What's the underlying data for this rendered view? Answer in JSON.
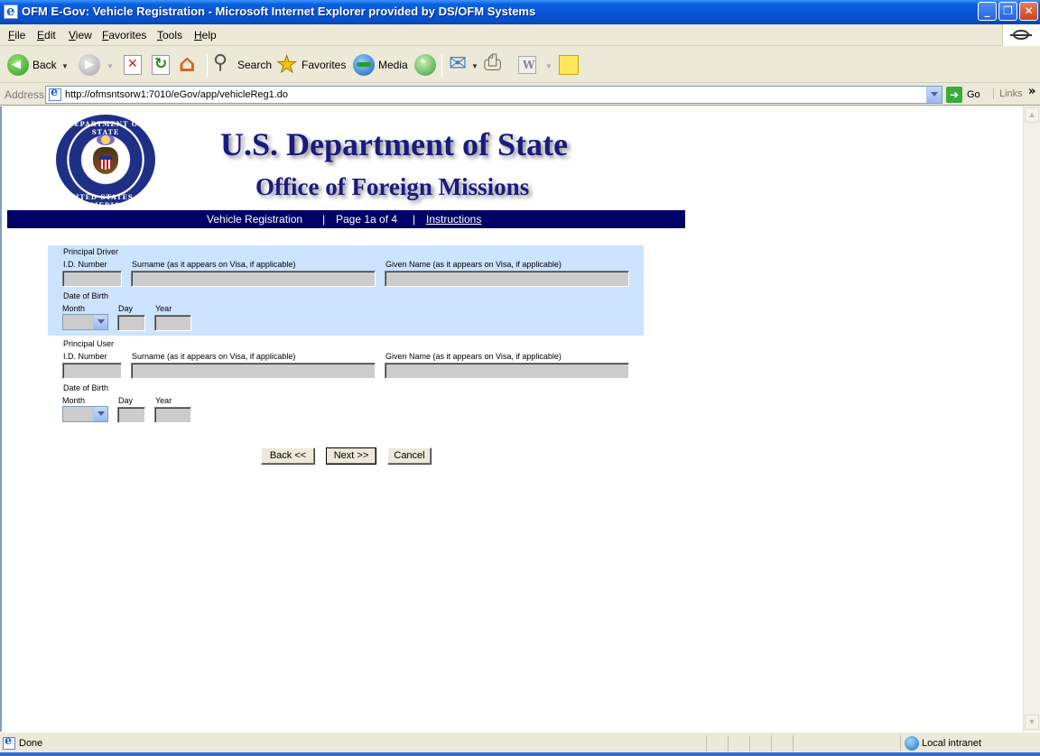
{
  "window": {
    "title": "OFM E-Gov: Vehicle Registration - Microsoft Internet Explorer provided by DS/OFM Systems",
    "minimize": "_",
    "restore": "❐",
    "close": "✕"
  },
  "menu": [
    "File",
    "Edit",
    "View",
    "Favorites",
    "Tools",
    "Help"
  ],
  "toolbar": {
    "back": "Back",
    "search": "Search",
    "favorites": "Favorites",
    "media": "Media"
  },
  "address": {
    "label": "Address",
    "url": "http://ofmsntsorw1:7010/eGov/app/vehicleReg1.do",
    "go": "Go",
    "links": "Links",
    "chevron": "»"
  },
  "header": {
    "seal_top": "DEPARTMENT OF STATE",
    "seal_bottom": "UNITED STATES OF AMERICA",
    "title": "U.S. Department of State",
    "subtitle": "Office of Foreign Missions"
  },
  "nav": {
    "section": "Vehicle Registration",
    "sep": "|",
    "page": "Page 1a of 4",
    "instructions": "Instructions"
  },
  "principal_driver": {
    "heading": "Principal Driver",
    "id_label": "I.D. Number",
    "surname_label": "Surname (as it appears on Visa, if applicable)",
    "given_label": "Given Name (as it appears on Visa, if applicable)",
    "dob_label": "Date of Birth",
    "month_label": "Month",
    "day_label": "Day",
    "year_label": "Year"
  },
  "principal_user": {
    "heading": "Principal User",
    "id_label": "I.D. Number",
    "surname_label": "Surname (as it appears on Visa, if applicable)",
    "given_label": "Given Name (as it appears on Visa, if applicable)",
    "dob_label": "Date of Birth",
    "month_label": "Month",
    "day_label": "Day",
    "year_label": "Year"
  },
  "buttons": {
    "back": "Back <<",
    "next": "Next >>",
    "cancel": "Cancel"
  },
  "status": {
    "text": "Done",
    "zone": "Local intranet"
  },
  "scroll": {
    "up": "▲",
    "down": "▼"
  }
}
